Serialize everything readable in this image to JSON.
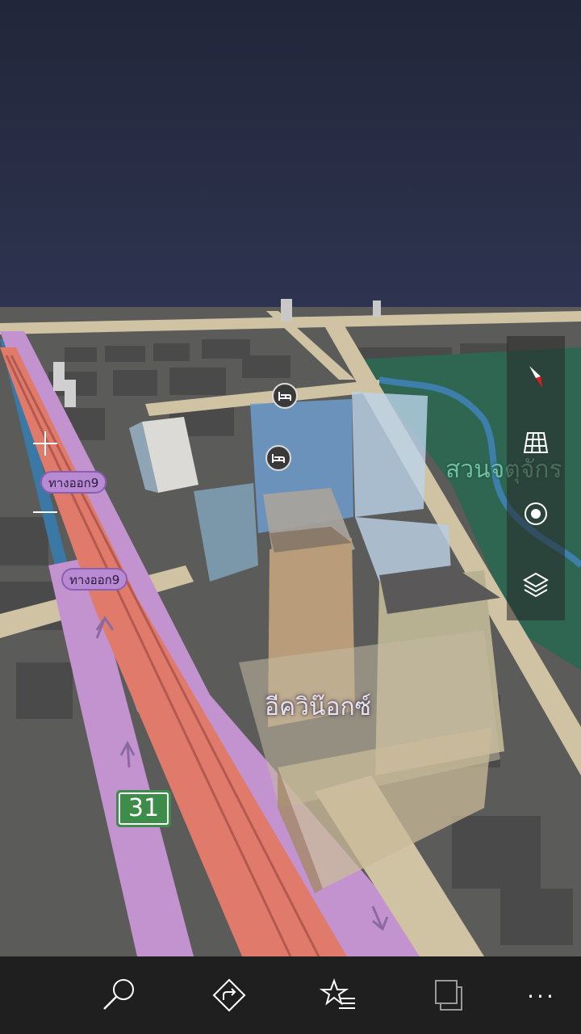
{
  "map": {
    "place_label": "อีควิน๊อกซ์",
    "park_label": "สวนจตุจักร",
    "exit_labels": [
      "ทางออก9",
      "ทางออก9"
    ],
    "highway_shield": "31",
    "poi_icons": [
      "hotel-icon",
      "hotel-icon"
    ],
    "colors": {
      "sky": "#24283f",
      "ground": "#5a5a58",
      "road_major": "#d6c9a8",
      "expressway": "#e07a6a",
      "ramp": "#c48fd0",
      "park": "#2f6a56",
      "water": "#3a78a6"
    }
  },
  "map_controls": {
    "zoom_in": "plus-icon",
    "zoom_out": "minus-icon"
  },
  "side_panel": {
    "buttons": [
      "compass-icon",
      "3d-buildings-icon",
      "my-location-icon",
      "layers-icon"
    ]
  },
  "app_bar": {
    "buttons": [
      "search-icon",
      "directions-icon",
      "favorites-icon",
      "cities-icon",
      "more-icon"
    ],
    "more_label": "..."
  }
}
